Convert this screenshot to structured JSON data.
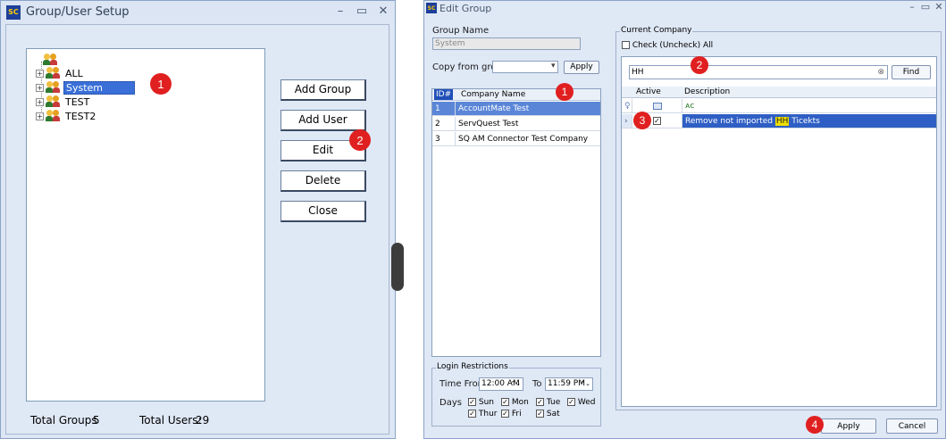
{
  "left_window": {
    "title": "Group/User Setup",
    "tree": {
      "items": [
        {
          "label": "ALL"
        },
        {
          "label": "System"
        },
        {
          "label": "TEST"
        },
        {
          "label": "TEST2"
        }
      ]
    },
    "buttons": {
      "add_group": "Add Group",
      "add_user": "Add User",
      "edit": "Edit",
      "delete": "Delete",
      "close": "Close"
    },
    "footer": {
      "groups_label": "Total Groups",
      "groups_value": "5",
      "users_label": "Total Users:",
      "users_value": "29"
    }
  },
  "right_window": {
    "title": "Edit Group",
    "group_name_label": "Group Name",
    "group_name_value": "System",
    "copy_from_label": "Copy from group",
    "copy_from_value": "",
    "apply_small": "Apply",
    "company_grid": {
      "headers": [
        "ID#",
        "Company Name"
      ],
      "rows": [
        {
          "id": "1",
          "name": "AccountMate Test"
        },
        {
          "id": "2",
          "name": "ServQuest Test"
        },
        {
          "id": "3",
          "name": "SQ AM Connector Test Company"
        }
      ]
    },
    "current_company": {
      "title": "Current Company",
      "check_all_label": "Check (Uncheck) All",
      "search_value": "HH",
      "find_label": "Find",
      "headers": [
        "Active",
        "Description"
      ],
      "filter_desc": "ᴀc",
      "row_desc_before": "Remove not imported ",
      "row_desc_highlight": "HH",
      "row_desc_after": " Ticekts"
    },
    "login_restrictions": {
      "title": "Login Restrictions",
      "time_from_label": "Time From",
      "time_from_value": "12:00 AM",
      "to_label": "To",
      "to_value": "11:59 PM",
      "days_label": "Days",
      "days": [
        "Sun",
        "Mon",
        "Tue",
        "Wed",
        "Thur",
        "Fri",
        "Sat"
      ]
    },
    "apply_label": "Apply",
    "cancel_label": "Cancel"
  },
  "badges": [
    "1",
    "2",
    "1",
    "2",
    "3",
    "4"
  ],
  "colors": {
    "badge": "#e02020",
    "selection": "#3a6fd8",
    "highlight": "#f0e000"
  }
}
